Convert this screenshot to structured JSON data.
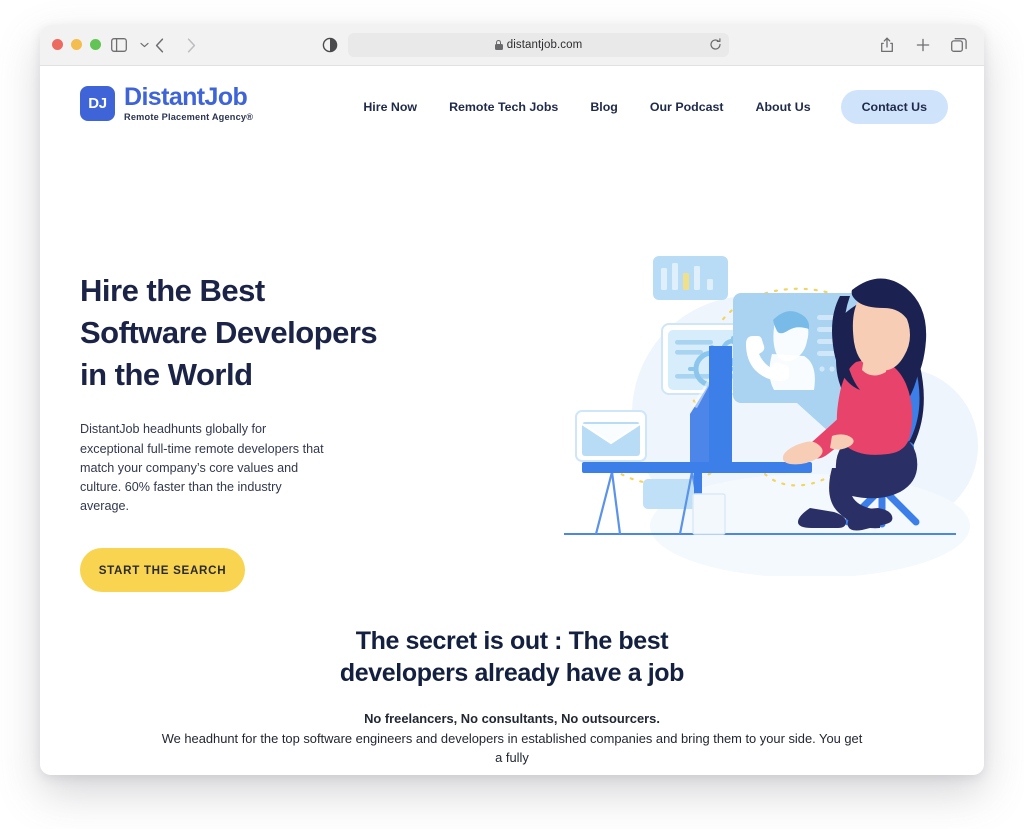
{
  "browser": {
    "url": "distantjob.com",
    "secure": true,
    "traffic_lights": [
      "close",
      "minimize",
      "maximize"
    ],
    "toolbar_icons": {
      "sidebar": "sidebar-icon",
      "sidebar_menu": "chevron-down-icon",
      "back": "back-arrow-icon",
      "forward": "forward-arrow-icon",
      "reader": "reader-mode-icon",
      "reload": "reload-icon",
      "share": "share-icon",
      "new_tab": "plus-icon",
      "tab_overview": "tabs-overview-icon"
    }
  },
  "site": {
    "logo": {
      "mark": "DJ",
      "wordmark": "DistantJob",
      "tagline": "Remote Placement Agency®"
    },
    "nav": {
      "items": [
        {
          "label": "Hire Now"
        },
        {
          "label": "Remote Tech Jobs"
        },
        {
          "label": "Blog"
        },
        {
          "label": "Our Podcast"
        },
        {
          "label": "About Us"
        }
      ],
      "cta": {
        "label": "Contact Us"
      }
    },
    "hero": {
      "title_lines": [
        "Hire the Best",
        "Software Developers",
        "in the World"
      ],
      "title": "Hire the Best Software Developers in the World",
      "subtitle": "DistantJob headhunts globally for exceptional full-time remote developers that match your company’s core values and culture. 60% faster than the industry average.",
      "cta_label": "START THE SEARCH",
      "illustration": "woman-at-desk-illustration"
    },
    "secret_section": {
      "title_lines": [
        "The secret is out : The best",
        "developers already have a job"
      ],
      "title": "The secret is out : The best developers already have a job",
      "lead": "No freelancers, No consultants, No outsourcers.",
      "body": "We headhunt for the top software engineers and developers in established companies and bring them to your side. You get a fully"
    }
  },
  "colors": {
    "brand_blue": "#3f64d8",
    "navy_text": "#1b2447",
    "cta_yellow": "#f8d451",
    "contact_pill": "#cfe3fb",
    "illustration_blue": "#3d7fe8",
    "illustration_light_blue": "#a8d2f0",
    "illustration_pink": "#e8436a",
    "illustration_hair": "#1b2252",
    "dotted_yellow": "#f6d96a"
  }
}
